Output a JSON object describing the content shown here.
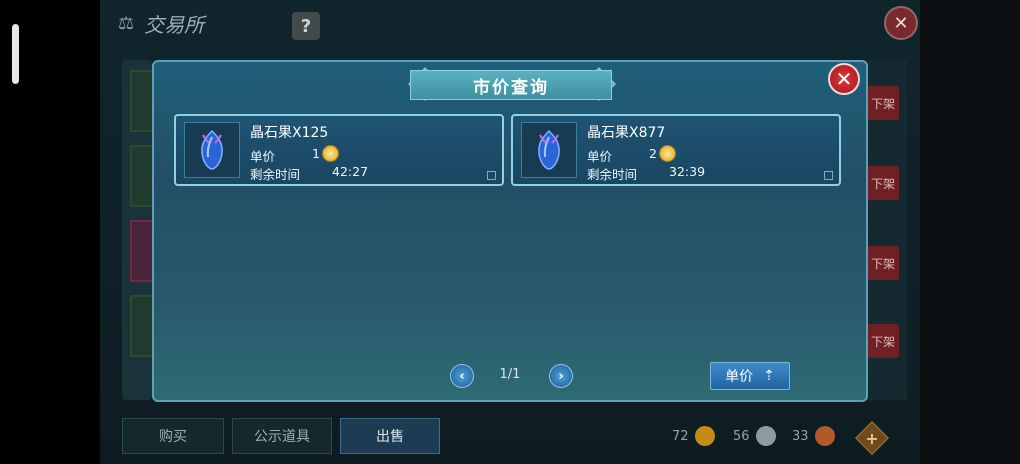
{
  "background": {
    "title": "交易所",
    "help_label": "?",
    "close_label": "✕",
    "offshelf_label": "下架",
    "tabs": [
      {
        "label": "购买"
      },
      {
        "label": "公示道具"
      },
      {
        "label": "出售"
      }
    ],
    "currencies": [
      {
        "value": "72",
        "color": "#c58b16"
      },
      {
        "value": "56",
        "color": "#8d9aa3"
      },
      {
        "value": "33",
        "color": "#b05a2c"
      }
    ],
    "plus_label": "+"
  },
  "dialog": {
    "title": "市价查询",
    "close_label": "✕",
    "price_label": "单价",
    "time_label": "剩余时间",
    "items": [
      {
        "name": "晶石果X125",
        "price": "1",
        "time": "42:27"
      },
      {
        "name": "晶石果X877",
        "price": "2",
        "time": "32:39"
      }
    ],
    "pagination": {
      "prev": "‹",
      "text": "1/1",
      "next": "›"
    },
    "sort_button": {
      "label": "单价",
      "arrow": "⇡"
    }
  }
}
